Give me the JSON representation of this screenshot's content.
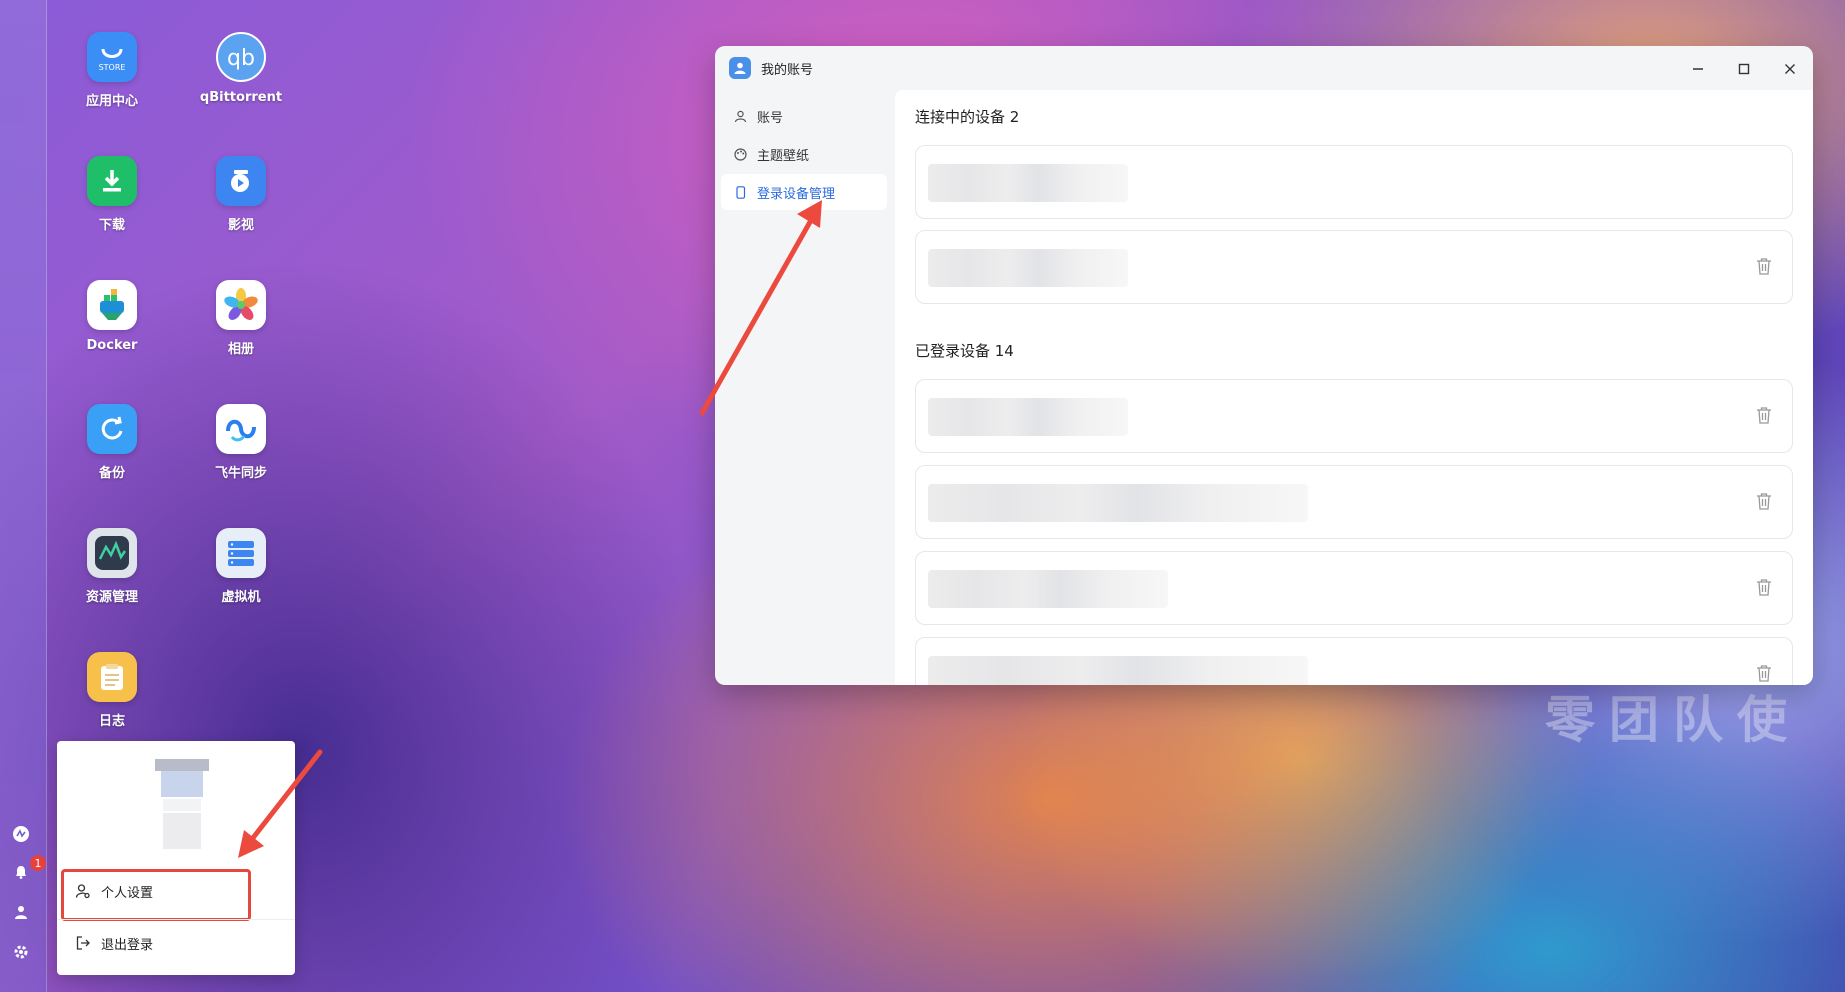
{
  "desktop": {
    "apps": [
      {
        "label": "应用中心",
        "icon": "store-icon",
        "color": "#3a8ef6",
        "sub": "STORE"
      },
      {
        "label": "qBittorrent",
        "icon": "qbittorrent-icon",
        "color": "#5ba3f0",
        "sub": "qb"
      },
      {
        "label": "下载",
        "icon": "download-icon",
        "color": "#1fbf6a",
        "sub": ""
      },
      {
        "label": "影视",
        "icon": "video-icon",
        "color": "#3d86f2",
        "sub": ""
      },
      {
        "label": "Docker",
        "icon": "docker-icon",
        "color": "#ffffff",
        "sub": ""
      },
      {
        "label": "相册",
        "icon": "photos-icon",
        "color": "#ffffff",
        "sub": ""
      },
      {
        "label": "备份",
        "icon": "backup-icon",
        "color": "#3aa0f5",
        "sub": ""
      },
      {
        "label": "飞牛同步",
        "icon": "sync-icon",
        "color": "#ffffff",
        "sub": ""
      },
      {
        "label": "资源管理",
        "icon": "resource-monitor-icon",
        "color": "#2f3b4c",
        "sub": ""
      },
      {
        "label": "虚拟机",
        "icon": "vm-icon",
        "color": "#e8eef8",
        "sub": ""
      },
      {
        "label": "日志",
        "icon": "log-icon",
        "color": "#f6c04a",
        "sub": ""
      }
    ],
    "notification_count": "1",
    "watermark": "零团队使"
  },
  "window": {
    "title": "我的账号",
    "nav": [
      {
        "label": "账号",
        "icon": "user-icon",
        "active": false
      },
      {
        "label": "主题壁纸",
        "icon": "palette-icon",
        "active": false
      },
      {
        "label": "登录设备管理",
        "icon": "device-icon",
        "active": true
      }
    ],
    "connected_title": "连接中的设备 2",
    "logged_title": "已登录设备 14"
  },
  "popup": {
    "personal_settings": "个人设置",
    "logout": "退出登录"
  },
  "colors": {
    "accent": "#2a6ae0",
    "highlight": "#e5483c"
  }
}
